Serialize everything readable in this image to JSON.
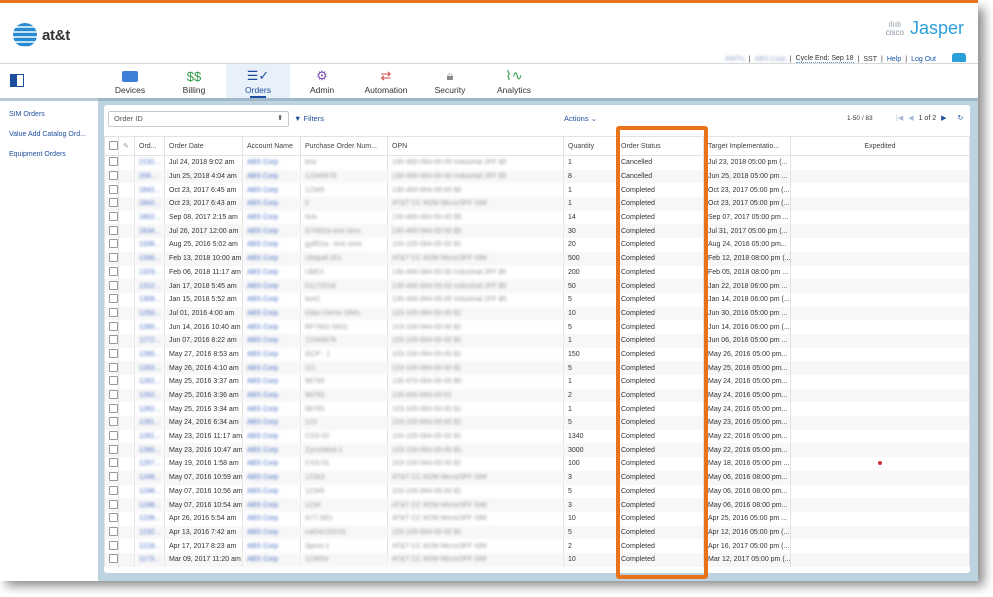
{
  "brand": {
    "logo_text": "at&t",
    "cisco_label": "cisco",
    "product_name": "Jasper"
  },
  "utility_bar": {
    "user": "IHRTu",
    "account": "ABS Corp",
    "cycle_end": "Cycle End: Sep 18",
    "timezone": "SST",
    "help": "Help",
    "logout": "Log Out"
  },
  "nav": {
    "items": [
      {
        "label": "Devices",
        "icon": "devices-icon",
        "active": false
      },
      {
        "label": "Billing",
        "icon": "billing-icon",
        "active": false
      },
      {
        "label": "Orders",
        "icon": "orders-icon",
        "active": true
      },
      {
        "label": "Admin",
        "icon": "gear-icon",
        "active": false
      },
      {
        "label": "Automation",
        "icon": "automation-icon",
        "active": false
      },
      {
        "label": "Security",
        "icon": "lock-icon",
        "active": false
      },
      {
        "label": "Analytics",
        "icon": "analytics-icon",
        "active": false
      }
    ]
  },
  "sidebar": {
    "items": [
      {
        "label": "SIM Orders"
      },
      {
        "label": "Value Add Catalog Ord..."
      },
      {
        "label": "Equipment Orders"
      }
    ]
  },
  "toolbar": {
    "search_field": "Order ID",
    "filters_label": "Filters",
    "actions_label": "Actions",
    "range": "1-50 / 83",
    "page": "1 of 2"
  },
  "table": {
    "columns": [
      "",
      "",
      "Ord...",
      "Order Date",
      "Account Name",
      "Purchase Order Num...",
      "OPN",
      "Quantity",
      "Order Status",
      "Target Implementatio...",
      "Expedited"
    ],
    "rows": [
      {
        "id": "2132...",
        "date": "Jul 24, 2018 9:02 am",
        "account": "ABS Corp",
        "po": "test",
        "opn": "130-460-064-00-00 Industrial 2FF $5",
        "qty": "1",
        "status": "Cancelled",
        "target": "Jul 23, 2018 05:00 pm (...",
        "expedited": false
      },
      {
        "id": "209...",
        "date": "Jun 25, 2018 4:04 am",
        "account": "ABS Corp",
        "po": "12345678",
        "opn": "130-460-064-00-00 Industrial 2FF $5",
        "qty": "8",
        "status": "Cancelled",
        "target": "Jun 25, 2018 05:00 pm ...",
        "expedited": false
      },
      {
        "id": "1842...",
        "date": "Oct 23, 2017 6:45 am",
        "account": "ABS Corp",
        "po": "12345",
        "opn": "130-460-064-00-00 $5",
        "qty": "1",
        "status": "Completed",
        "target": "Oct 23, 2017 05:00 pm (...",
        "expedited": false
      },
      {
        "id": "1842...",
        "date": "Oct 23, 2017 6:43 am",
        "account": "ABS Corp",
        "po": "0",
        "opn": "AT&T CC M2M Micro/3FF SIM",
        "qty": "1",
        "status": "Completed",
        "target": "Oct 23, 2017 05:00 pm (...",
        "expedited": false
      },
      {
        "id": "1802...",
        "date": "Sep 08, 2017 2:15 am",
        "account": "ABS Corp",
        "po": "N/A",
        "opn": "130-460-064-00-00 $5",
        "qty": "14",
        "status": "Completed",
        "target": "Sep 07, 2017 05:00 pm ...",
        "expedited": false
      },
      {
        "id": "1634...",
        "date": "Jul 26, 2017 12:00 am",
        "account": "ABS Corp",
        "po": "GY852a-test sims",
        "opn": "130-460-064-00-00 $5",
        "qty": "30",
        "status": "Completed",
        "target": "Jul 31, 2017 05:00 pm (...",
        "expedited": false
      },
      {
        "id": "1336...",
        "date": "Aug 25, 2016 5:02 am",
        "account": "ABS Corp",
        "po": "gy852a - test sims",
        "opn": "103-100-064-00-00 $1",
        "qty": "20",
        "status": "Completed",
        "target": "Aug 24, 2016 05:00 pm...",
        "expedited": false
      },
      {
        "id": "1336...",
        "date": "Feb 13, 2018 10:00 am",
        "account": "ABS Corp",
        "po": "Ubiquiti 001",
        "opn": "AT&T CC M2M Micro/3FF SIM",
        "qty": "500",
        "status": "Completed",
        "target": "Feb 12, 2018 08:00 pm (...",
        "expedited": false
      },
      {
        "id": "1329...",
        "date": "Feb 06, 2018 11:17 am",
        "account": "ABS Corp",
        "po": "UBEX",
        "opn": "130-460-064-00-00 Industrial 2FF $5",
        "qty": "200",
        "status": "Completed",
        "target": "Feb 05, 2018 08:00 pm ...",
        "expedited": false
      },
      {
        "id": "1312...",
        "date": "Jan 17, 2018 5:45 am",
        "account": "ABS Corp",
        "po": "01172018",
        "opn": "130-460-064-00-00 Industrial 2FF $5",
        "qty": "50",
        "status": "Completed",
        "target": "Jan 22, 2018 06:00 pm ...",
        "expedited": false
      },
      {
        "id": "1309...",
        "date": "Jan 15, 2018 5:52 am",
        "account": "ABS Corp",
        "po": "test1",
        "opn": "130-460-064-00-00 Industrial 2FF $5",
        "qty": "5",
        "status": "Completed",
        "target": "Jan 14, 2018 06:00 pm (...",
        "expedited": false
      },
      {
        "id": "1293...",
        "date": "Jul 01, 2016 4:00 am",
        "account": "ABS Corp",
        "po": "Gilan Demo SIMs",
        "opn": "103-100-064-00-00 $1",
        "qty": "10",
        "status": "Completed",
        "target": "Jun 30, 2016 05:00 pm ...",
        "expedited": false
      },
      {
        "id": "1280...",
        "date": "Jun 14, 2016 10:40 am",
        "account": "ABS Corp",
        "po": "RF7601-0001",
        "opn": "103-100-064-00-00 $1",
        "qty": "5",
        "status": "Completed",
        "target": "Jun 14, 2016 06:00 pm (...",
        "expedited": false
      },
      {
        "id": "1272...",
        "date": "Jun 07, 2016 8:22 am",
        "account": "ABS Corp",
        "po": "12345678",
        "opn": "103-100-064-00-00 $1",
        "qty": "1",
        "status": "Completed",
        "target": "Jun 06, 2016 05:00 pm ...",
        "expedited": false
      },
      {
        "id": "1265...",
        "date": "May 27, 2016 8:53 am",
        "account": "ABS Corp",
        "po": "GCP - 1",
        "opn": "103-100-064-00-00 $1",
        "qty": "150",
        "status": "Completed",
        "target": "May 26, 2016 05:00 pm...",
        "expedited": false
      },
      {
        "id": "1263...",
        "date": "May 26, 2016 4:10 am",
        "account": "ABS Corp",
        "po": "111",
        "opn": "103-100-064-00-00 $1",
        "qty": "5",
        "status": "Completed",
        "target": "May 25, 2016 05:00 pm...",
        "expedited": false
      },
      {
        "id": "1262...",
        "date": "May 25, 2016 3:37 am",
        "account": "ABS Corp",
        "po": "98765",
        "opn": "130-470-064-00-00 $0",
        "qty": "1",
        "status": "Completed",
        "target": "May 24, 2016 05:00 pm...",
        "expedited": false
      },
      {
        "id": "1262...",
        "date": "May 25, 2016 3:36 am",
        "account": "ABS Corp",
        "po": "98765",
        "opn": "130-400-064-00-01",
        "qty": "2",
        "status": "Completed",
        "target": "May 24, 2016 05:00 pm...",
        "expedited": false
      },
      {
        "id": "1262...",
        "date": "May 25, 2016 3:34 am",
        "account": "ABS Corp",
        "po": "98765",
        "opn": "103-100-064-00-00 $1",
        "qty": "1",
        "status": "Completed",
        "target": "May 24, 2016 05:00 pm...",
        "expedited": false
      },
      {
        "id": "1261...",
        "date": "May 24, 2016 6:34 am",
        "account": "ABS Corp",
        "po": "123",
        "opn": "103-100-064-00-00 $1",
        "qty": "5",
        "status": "Completed",
        "target": "May 23, 2016 05:00 pm...",
        "expedited": false
      },
      {
        "id": "1261...",
        "date": "May 23, 2016 11:17 am",
        "account": "ABS Corp",
        "po": "CSS-02",
        "opn": "103-100-064-00-00 $1",
        "qty": "1340",
        "status": "Completed",
        "target": "May 22, 2016 05:00 pm...",
        "expedited": false
      },
      {
        "id": "1260...",
        "date": "May 23, 2016 10:47 am",
        "account": "ABS Corp",
        "po": "ZyrusMed-1",
        "opn": "103-100-064-00-00 $1",
        "qty": "3000",
        "status": "Completed",
        "target": "May 22, 2016 05:00 pm...",
        "expedited": false
      },
      {
        "id": "1257...",
        "date": "May 19, 2016 1:58 am",
        "account": "ABS Corp",
        "po": "CSS-01",
        "opn": "103-100-064-00-00 $1",
        "qty": "100",
        "status": "Completed",
        "target": "May 18, 2016 05:00 pm ...",
        "expedited": true
      },
      {
        "id": "1248...",
        "date": "May 07, 2016 10:59 am",
        "account": "ABS Corp",
        "po": "12343",
        "opn": "AT&T CC M2M Micro/3FF SIM",
        "qty": "3",
        "status": "Completed",
        "target": "May 06, 2016 08:00 pm...",
        "expedited": false
      },
      {
        "id": "1248...",
        "date": "May 07, 2016 10:56 am",
        "account": "ABS Corp",
        "po": "12345",
        "opn": "103-100-064-00-00 $1",
        "qty": "5",
        "status": "Completed",
        "target": "May 06, 2016 08:00 pm...",
        "expedited": false
      },
      {
        "id": "1248...",
        "date": "May 07, 2016 10:54 am",
        "account": "ABS Corp",
        "po": "1234",
        "opn": "AT&T CC M2M Micro/3FF SIM",
        "qty": "3",
        "status": "Completed",
        "target": "May 06, 2016 08:00 pm...",
        "expedited": false
      },
      {
        "id": "1239...",
        "date": "Apr 26, 2016 5:54 am",
        "account": "ABS Corp",
        "po": "A77-SEs",
        "opn": "AT&T CC M2M Micro/3FF SIM",
        "qty": "10",
        "status": "Completed",
        "target": "Apr 25, 2016 05:00 pm ...",
        "expedited": false
      },
      {
        "id": "1232...",
        "date": "Apr 13, 2016 7:42 am",
        "account": "ABS Corp",
        "po": "cat04132016",
        "opn": "103-100-064-00-00 $1",
        "qty": "5",
        "status": "Completed",
        "target": "Apr 12, 2016 05:00 pm (...",
        "expedited": false
      },
      {
        "id": "1218...",
        "date": "Apr 17, 2017 8:23 am",
        "account": "ABS Corp",
        "po": "Sprint-1",
        "opn": "AT&T CC M2M Micro/3FF SIM",
        "qty": "2",
        "status": "Completed",
        "target": "Apr 16, 2017 05:00 pm (...",
        "expedited": false
      },
      {
        "id": "1173...",
        "date": "Mar 09, 2017 11:20 am",
        "account": "ABS Corp",
        "po": "123654",
        "opn": "AT&T CC M2M Micro/3FF SIM",
        "qty": "10",
        "status": "Completed",
        "target": "Mar 12, 2017 05:00 pm (...",
        "expedited": false
      }
    ]
  },
  "colors": {
    "accent": "#e8731a",
    "link": "#1d4e9e",
    "jasper": "#2b9fd9"
  }
}
